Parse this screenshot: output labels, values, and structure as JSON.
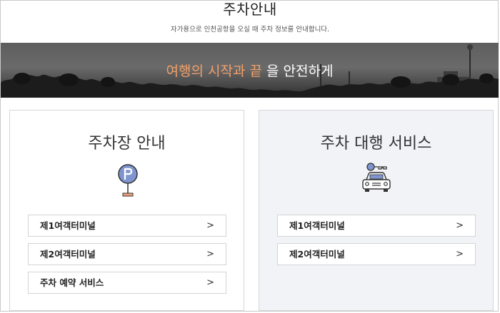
{
  "header": {
    "title": "주차안내",
    "subtitle": "자가용으로 인천공항을 오실 때 주차 정보를 안내합니다."
  },
  "banner": {
    "highlight_text": "여행의 시작과 끝",
    "rest_text": " 을 안전하게",
    "highlight_color": "#f2a068"
  },
  "parking_guide": {
    "title": "주차장 안내",
    "icon": "parking-sign-icon",
    "items": [
      {
        "label": "제1여객터미널",
        "chevron": ">"
      },
      {
        "label": "제2여객터미널",
        "chevron": ">"
      },
      {
        "label": "주차 예약 서비스",
        "chevron": ">"
      }
    ]
  },
  "valet_service": {
    "title": "주차 대행 서비스",
    "icon": "car-key-icon",
    "items": [
      {
        "label": "제1여객터미널",
        "chevron": ">"
      },
      {
        "label": "제2여객터미널",
        "chevron": ">"
      }
    ]
  },
  "colors": {
    "accent_blue": "#7f95cf",
    "valet_background": "#f2f3f7"
  }
}
